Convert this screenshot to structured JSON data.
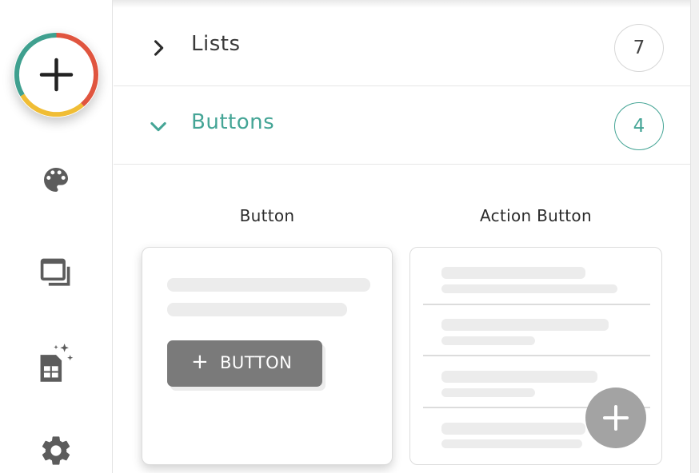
{
  "sidebar": {
    "add_button_icon": "plus-icon",
    "ring_colors": [
      "#3fa08f",
      "#e0553f",
      "#f0bd35"
    ],
    "items": [
      {
        "name": "palette-icon"
      },
      {
        "name": "windows-icon"
      },
      {
        "name": "sheet-sparkle-icon"
      },
      {
        "name": "gear-icon"
      }
    ]
  },
  "sections": [
    {
      "title": "Lists",
      "count": "7",
      "expanded": false
    },
    {
      "title": "Buttons",
      "count": "4",
      "expanded": true
    }
  ],
  "accent_color": "#45a596",
  "components": {
    "button": {
      "label": "Button",
      "demo_text": "BUTTON",
      "demo_icon": "plus-icon"
    },
    "action_button": {
      "label": "Action Button",
      "fab_icon": "plus-icon"
    }
  }
}
